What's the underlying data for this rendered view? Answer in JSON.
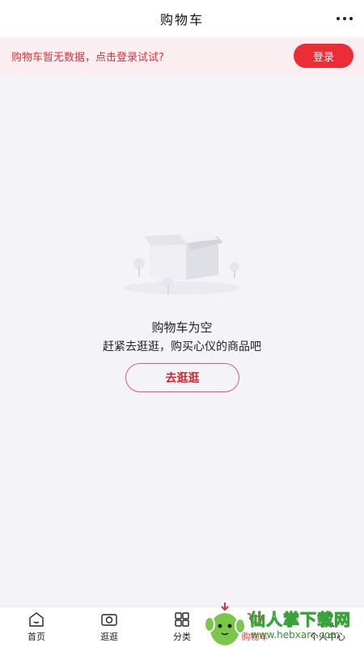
{
  "header": {
    "title": "购物车"
  },
  "banner": {
    "text": "购物车暂无数据，点击登录试试?",
    "login_label": "登录"
  },
  "empty_state": {
    "title": "购物车为空",
    "subtitle": "赶紧去逛逛，购买心仪的商品吧",
    "button_label": "去逛逛"
  },
  "tabs": [
    {
      "label": "首页",
      "icon": "home-icon"
    },
    {
      "label": "逛逛",
      "icon": "camera-icon"
    },
    {
      "label": "分类",
      "icon": "grid-icon"
    },
    {
      "label": "购物车",
      "icon": "cart-icon",
      "active": true
    },
    {
      "label": "个人中心",
      "icon": "user-icon"
    }
  ],
  "watermark": {
    "text": "仙人掌下载网",
    "url": "www.hebxarc.com"
  },
  "colors": {
    "accent": "#ea2d37",
    "banner_bg": "#fbeef0",
    "page_bg": "#f4f4f8"
  }
}
